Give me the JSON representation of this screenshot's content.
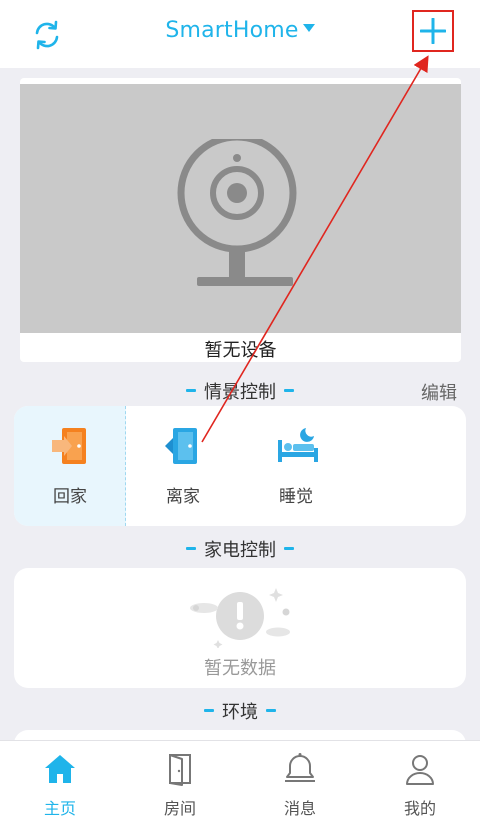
{
  "header": {
    "title": "SmartHome"
  },
  "camera": {
    "label": "暂无设备"
  },
  "scene": {
    "title": "情景控制",
    "edit_label": "编辑",
    "items": [
      {
        "label": "回家",
        "icon": "door-enter-icon"
      },
      {
        "label": "离家",
        "icon": "door-exit-icon"
      },
      {
        "label": "睡觉",
        "icon": "bed-icon"
      }
    ]
  },
  "appliance": {
    "title": "家电控制",
    "empty_label": "暂无数据"
  },
  "environment": {
    "title": "环境"
  },
  "tabs": [
    {
      "label": "主页",
      "icon": "home-icon"
    },
    {
      "label": "房间",
      "icon": "door-icon"
    },
    {
      "label": "消息",
      "icon": "bell-icon"
    },
    {
      "label": "我的",
      "icon": "user-icon"
    }
  ],
  "colors": {
    "accent": "#1fb4ea",
    "highlight": "#e0261f"
  }
}
